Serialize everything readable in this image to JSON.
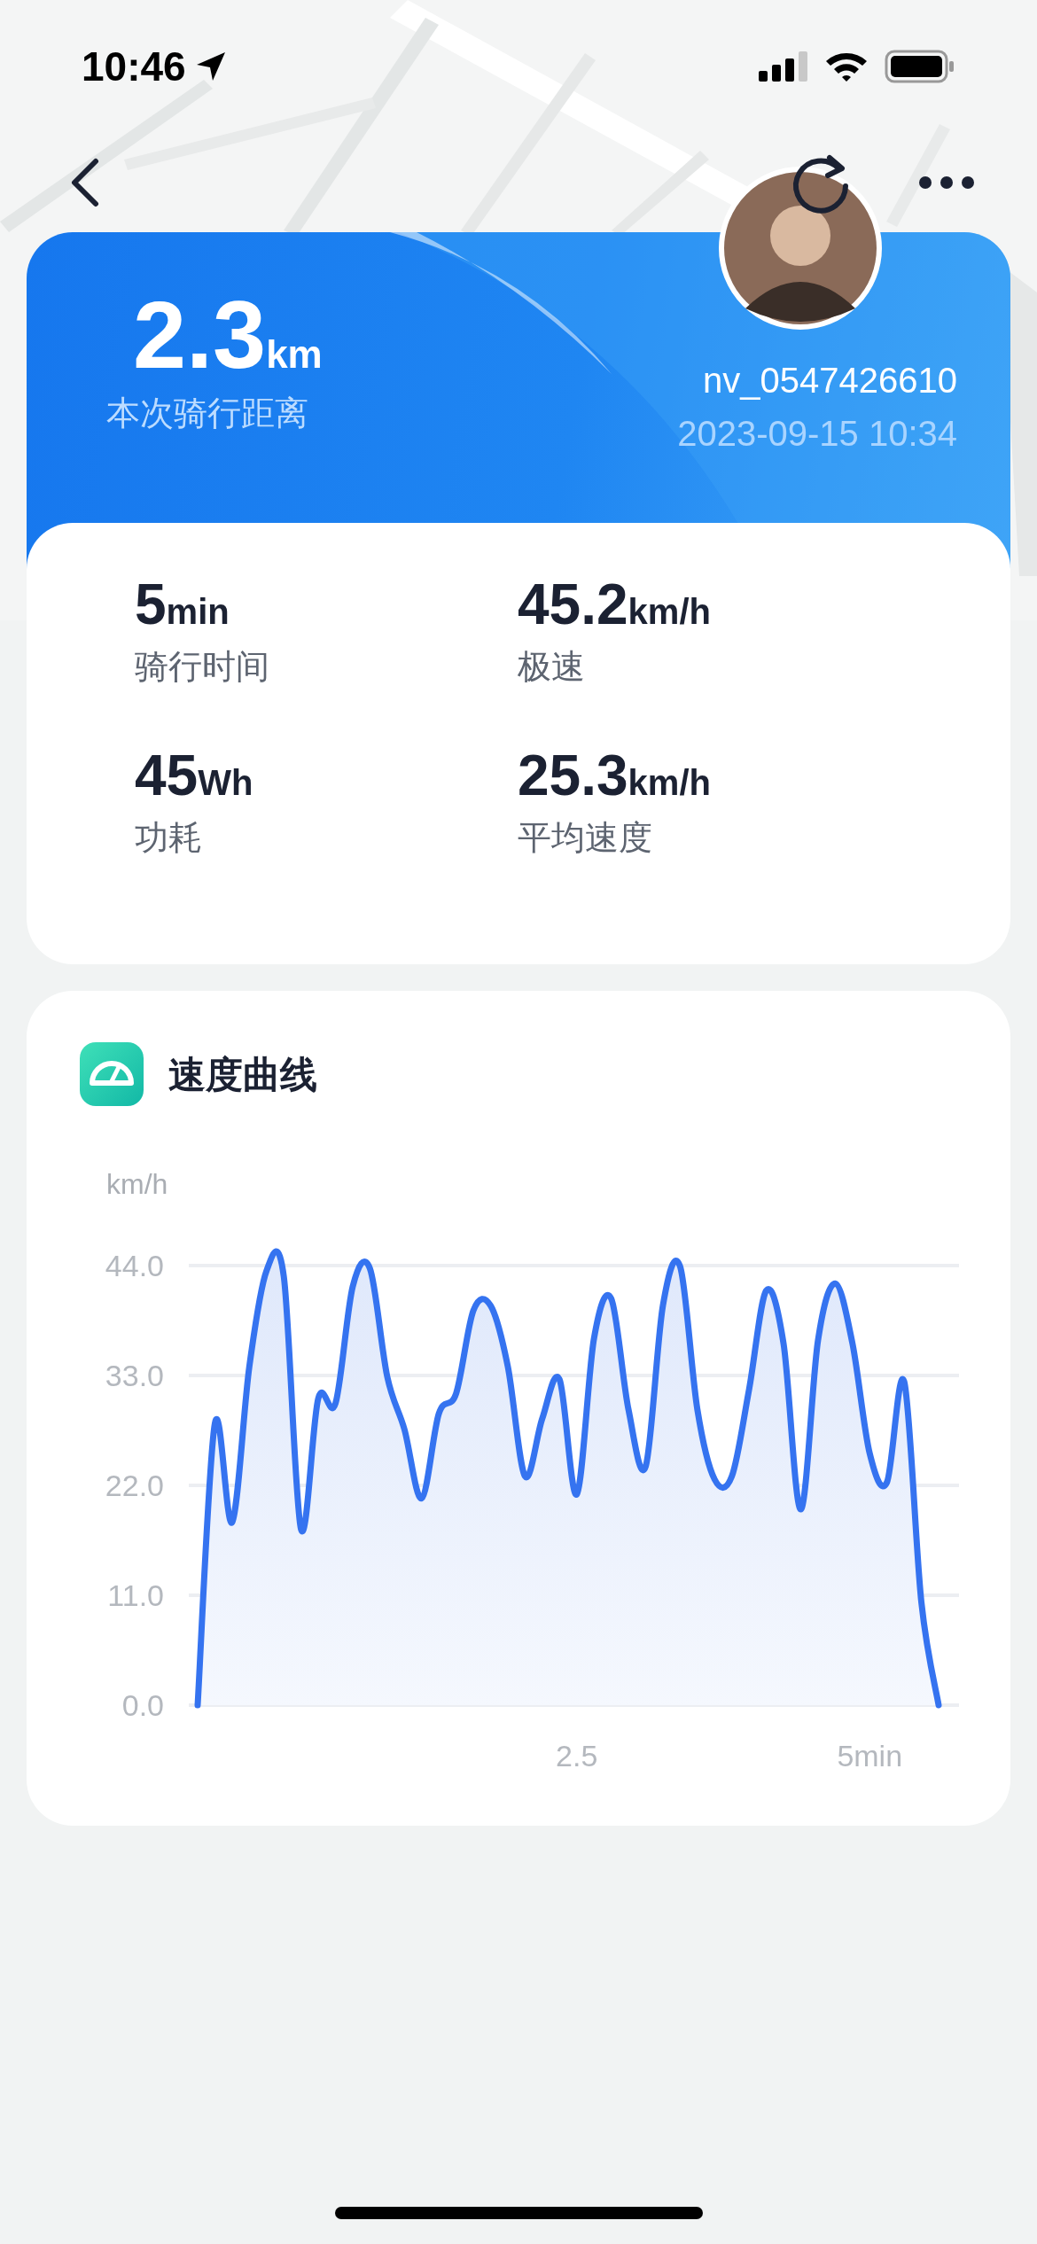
{
  "status_bar": {
    "time": "10:46"
  },
  "summary": {
    "distance": "2.3",
    "unit": "km",
    "label": "本次骑行距离",
    "username": "nv_0547426610",
    "datetime": "2023-09-15 10:34"
  },
  "stats": [
    {
      "value": "5",
      "unit": "min",
      "label": "骑行时间"
    },
    {
      "value": "45.2",
      "unit": "km/h",
      "label": "极速"
    },
    {
      "value": "45",
      "unit": "Wh",
      "label": "功耗"
    },
    {
      "value": "25.3",
      "unit": "km/h",
      "label": "平均速度"
    }
  ],
  "speed_card": {
    "title": "速度曲线",
    "chart_data": {
      "type": "area",
      "ylabel": "km/h",
      "categories": [
        null,
        null,
        null,
        null,
        null,
        null,
        null,
        null,
        null,
        null,
        null,
        null,
        null,
        null,
        null,
        null,
        null,
        null,
        null,
        null,
        null,
        null,
        "2.5",
        null,
        null,
        null,
        null,
        null,
        null,
        null,
        null,
        null,
        null,
        null,
        null,
        null,
        null,
        null,
        null,
        "5min",
        null,
        null,
        null,
        null
      ],
      "series": [
        {
          "color": "#3573f0",
          "values": [
            0,
            28.2,
            18.3,
            33.9,
            43.5,
            42.9,
            17.6,
            30.7,
            30.2,
            41.9,
            43.7,
            32.9,
            27.6,
            20.7,
            29.2,
            31.2,
            39.5,
            40.0,
            33.9,
            22.9,
            28.7,
            32.6,
            21.1,
            36.7,
            40.7,
            29.6,
            23.9,
            40.0,
            43.9,
            29.6,
            22.6,
            22.9,
            31.6,
            41.5,
            36.2,
            19.6,
            36.5,
            42.2,
            36.2,
            25.2,
            22.3,
            32.4,
            10.3,
            0
          ]
        }
      ],
      "ylim": [
        0,
        44
      ],
      "grid": true,
      "yticks": [
        {
          "value": 0,
          "label": "0.0"
        },
        {
          "value": 11,
          "label": "11.0"
        },
        {
          "value": 22,
          "label": "22.0"
        },
        {
          "value": 33,
          "label": "33.0"
        },
        {
          "value": 44,
          "label": "44.0"
        }
      ]
    }
  }
}
